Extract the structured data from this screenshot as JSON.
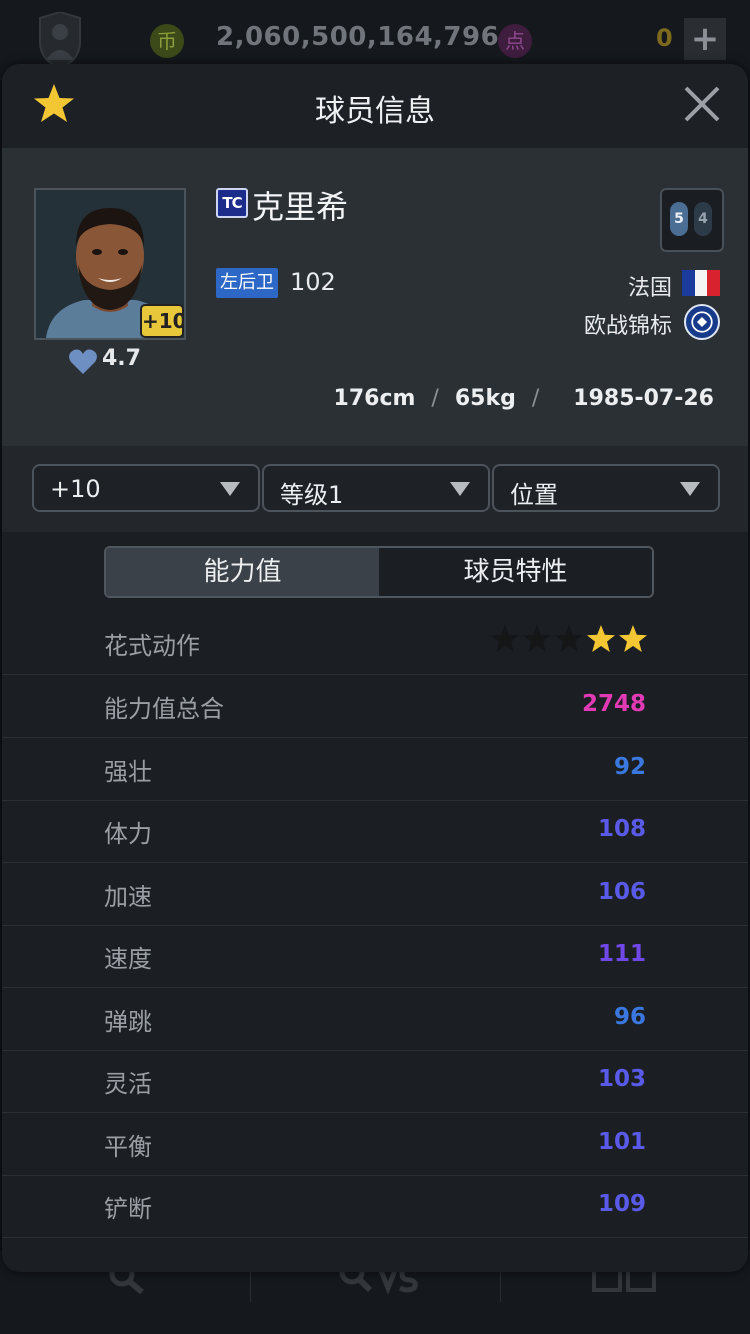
{
  "topbar": {
    "coin_icon": "币",
    "coin_value": "2,060,500,164,796",
    "point_icon": "点",
    "point_value": "0",
    "add_label": "+"
  },
  "modal": {
    "title": "球员信息"
  },
  "player": {
    "upgrade_badge": "+10",
    "rating": "4.7",
    "season_badge": "TC",
    "name": "克里希",
    "position": "左后卫",
    "overall": "102",
    "weak_foot_left": "5",
    "weak_foot_right": "4",
    "nation": "法国",
    "league": "欧战锦标",
    "height": "176cm",
    "weight": "65kg",
    "birth": "1985-07-26",
    "separator": "/"
  },
  "filters": {
    "upgrade": "+10",
    "level": "等级1",
    "position": "位置"
  },
  "tabs": {
    "ability": "能力值",
    "traits": "球员特性"
  },
  "stats": {
    "skill_moves_label": "花式动作",
    "skill_moves_stars": 2,
    "skill_moves_max": 5,
    "rows": [
      {
        "label": "能力值总合",
        "value": "2748",
        "color": "#e23ab5"
      },
      {
        "label": "强壮",
        "value": "92",
        "color": "#3a78e0"
      },
      {
        "label": "体力",
        "value": "108",
        "color": "#5a5ae8"
      },
      {
        "label": "加速",
        "value": "106",
        "color": "#5a5ae8"
      },
      {
        "label": "速度",
        "value": "111",
        "color": "#7048e8"
      },
      {
        "label": "弹跳",
        "value": "96",
        "color": "#3a78e0"
      },
      {
        "label": "灵活",
        "value": "103",
        "color": "#5a5ae8"
      },
      {
        "label": "平衡",
        "value": "101",
        "color": "#5a5ae8"
      },
      {
        "label": "铲断",
        "value": "109",
        "color": "#5a5ae8"
      }
    ]
  },
  "colors": {
    "star_active": "#f3c733",
    "star_inactive": "#141618"
  }
}
